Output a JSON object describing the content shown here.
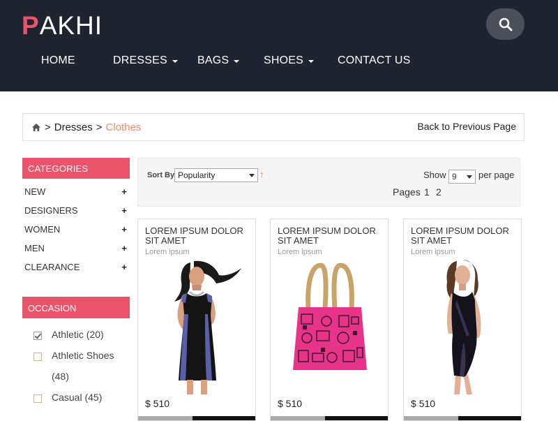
{
  "brand": {
    "first_letter": "P",
    "rest": "AKHI",
    "accent": "#e9546b"
  },
  "header": {
    "bg_color": "#1f2430",
    "search_icon": "search-icon",
    "nav": [
      {
        "label": "HOME",
        "dropdown": false
      },
      {
        "label": "DRESSES",
        "dropdown": true
      },
      {
        "label": "BAGS",
        "dropdown": true
      },
      {
        "label": "SHOES",
        "dropdown": true
      },
      {
        "label": "CONTACT US",
        "dropdown": false
      }
    ]
  },
  "breadcrumb": {
    "home_icon": "home-icon",
    "items": [
      ">",
      "Dresses",
      ">",
      "Clothes"
    ],
    "back_label": "Back to Previous Page"
  },
  "sidebar": {
    "categories_title": "CATEGORIES",
    "categories": [
      "NEW",
      "DESIGNERS",
      "WOMEN",
      "MEN",
      "CLEARANCE"
    ],
    "occasion_title": "OCCASION",
    "occasions": [
      {
        "label": "Athletic (20)",
        "checked": true
      },
      {
        "label": "Athletic Shoes (48)",
        "checked": false
      },
      {
        "label": "Casual (45)",
        "checked": false
      }
    ]
  },
  "toolbar": {
    "sort_label": "Sort By",
    "sort_value": "Popularity",
    "show_label": "Show",
    "show_value": "9",
    "per_page": "per page",
    "pages_label": "Pages",
    "pages": [
      "1",
      "2"
    ]
  },
  "products": [
    {
      "title": "LOREM IPSUM DOLOR SIT AMET",
      "subtitle": "Lorem ipsum",
      "price": "$ 510",
      "image": "woman-black-dress"
    },
    {
      "title": "LOREM IPSUM DOLOR SIT AMET",
      "subtitle": "Lorem ipsum",
      "price": "$ 510",
      "image": "pink-tote-bag"
    },
    {
      "title": "LOREM IPSUM DOLOR SIT AMET",
      "subtitle": "Lorem ipsum",
      "price": "$ 510",
      "image": "woman-wrap-dress"
    }
  ]
}
